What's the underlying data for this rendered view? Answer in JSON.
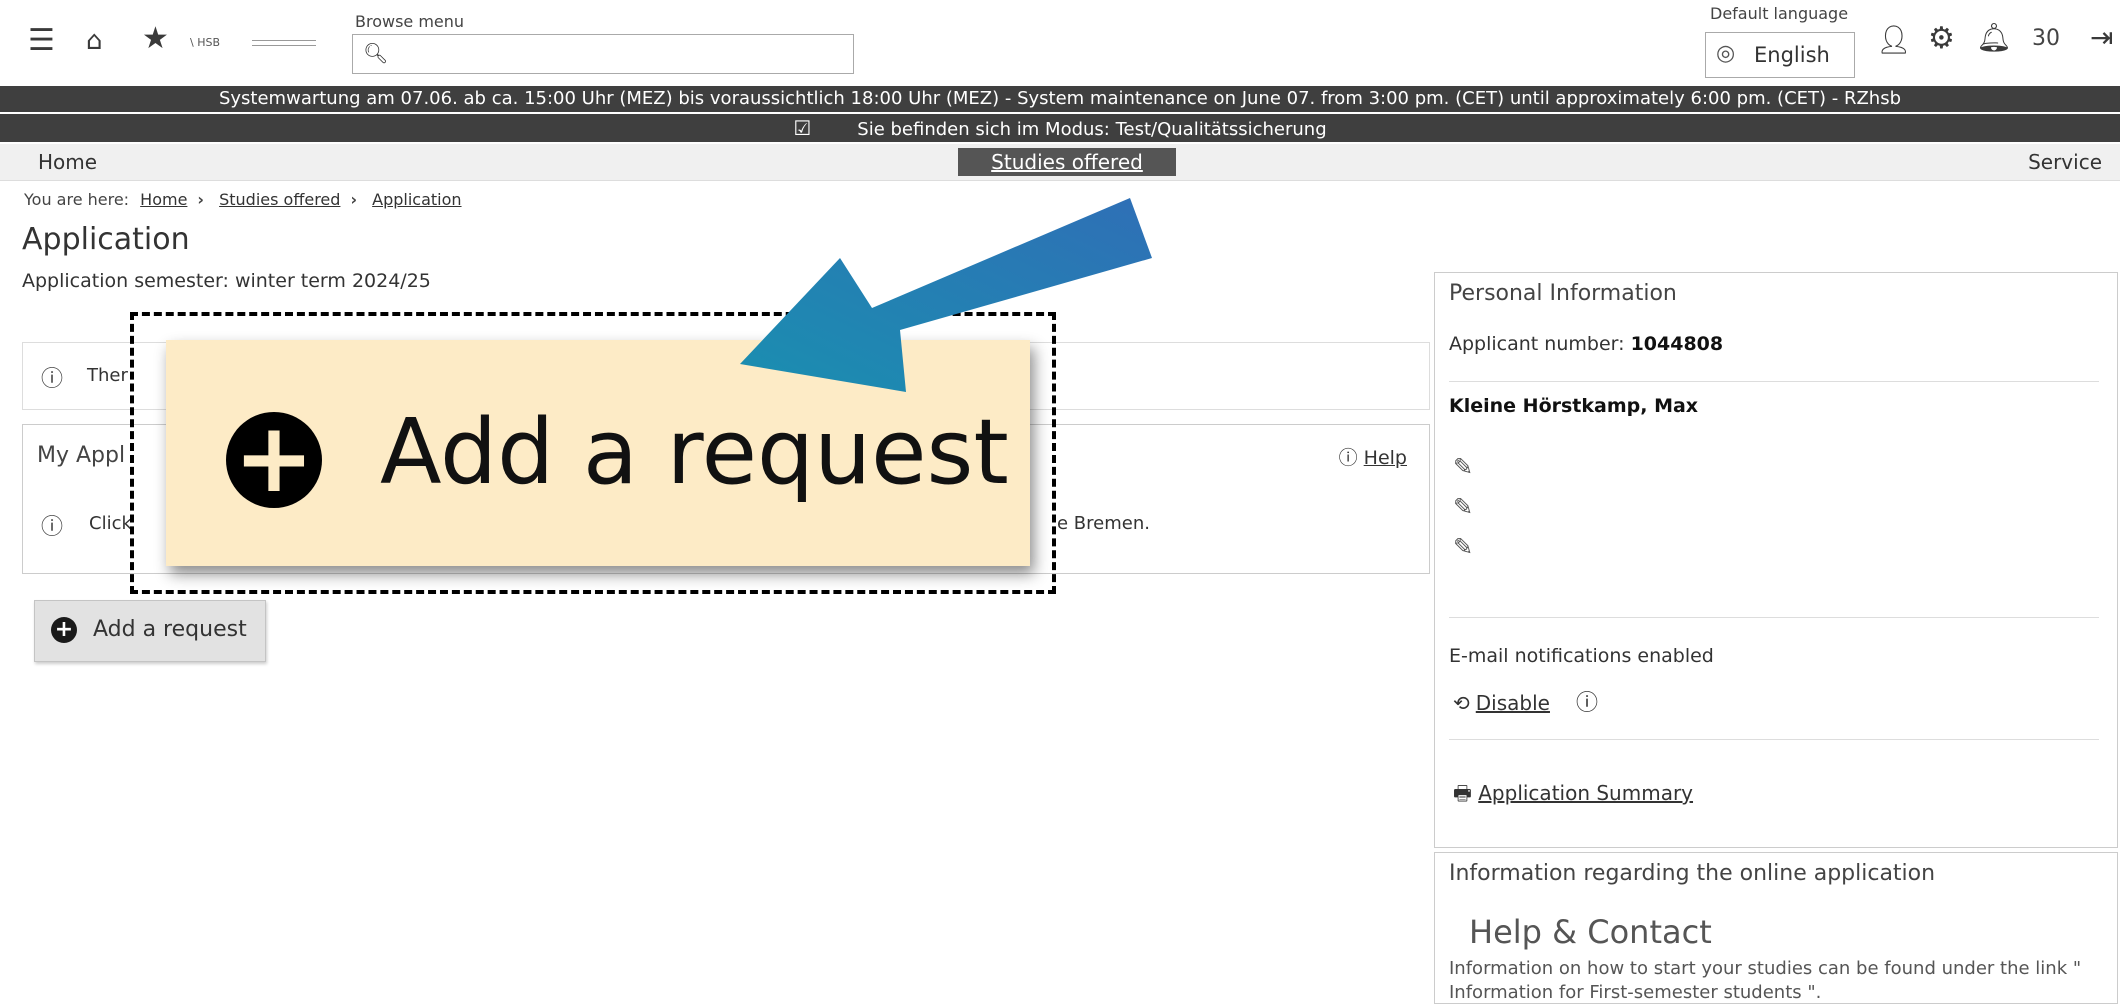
{
  "header": {
    "browse_label": "Browse menu",
    "logo_text": "\\ HSB",
    "lang_label": "Default language",
    "lang_value": "English",
    "notification_count": "30"
  },
  "banners": {
    "maintenance": "Systemwartung am 07.06. ab ca. 15:00 Uhr (MEZ) bis voraussichtlich 18:00 Uhr (MEZ) - System maintenance on June 07. from 3:00 pm. (CET) until approximately 6:00 pm. (CET) - RZhsb",
    "mode": "Sie befinden sich im Modus: Test/Qualitätssicherung"
  },
  "nav": {
    "home": "Home",
    "studies": "Studies offered",
    "service": "Service"
  },
  "breadcrumb": {
    "prefix": "You are here:",
    "items": [
      "Home",
      "Studies offered",
      "Application"
    ]
  },
  "page": {
    "title": "Application",
    "semester": "Application semester: winter term 2024/25",
    "notice_prefix": "Ther",
    "my_applications": "My Appl",
    "help": "Help",
    "click_prefix": "Click",
    "click_suffix": "e Bremen.",
    "add_request": "Add a request"
  },
  "zoom": {
    "label": "Add a request"
  },
  "personal": {
    "title": "Personal Information",
    "applicant_label": "Applicant number:",
    "applicant_number": "1044808",
    "name": "Kleine Hörstkamp, Max",
    "email_notifications": "E-mail notifications enabled",
    "disable": "Disable",
    "summary": "Application Summary"
  },
  "info": {
    "title": "Information regarding the online application",
    "help_contact": "Help & Contact",
    "text": "Information on how to start your studies can be found under the link \" Information for First-semester students \"."
  }
}
